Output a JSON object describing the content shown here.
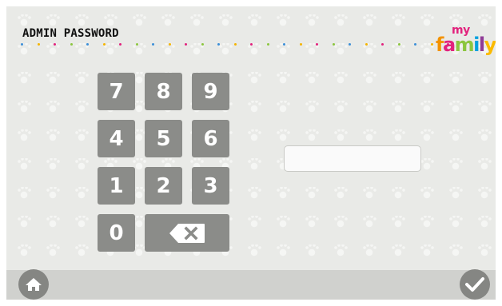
{
  "header": {
    "title": "ADMIN PASSWORD",
    "logo_top": "my",
    "logo_bottom": "family",
    "dot_colors": [
      "#3d8fd8",
      "#f5b400",
      "#e2227d",
      "#8cc63f"
    ]
  },
  "keypad": {
    "keys": [
      "7",
      "8",
      "9",
      "4",
      "5",
      "6",
      "1",
      "2",
      "3",
      "0"
    ],
    "backspace_icon": "backspace-icon"
  },
  "password": {
    "value": "",
    "placeholder": ""
  },
  "footer": {
    "home_icon": "home-icon",
    "confirm_icon": "checkmark-icon"
  },
  "colors": {
    "key_bg": "#8b8c89",
    "background": "#e9eae7",
    "bar": "#d0d1ce",
    "button": "#858683"
  }
}
